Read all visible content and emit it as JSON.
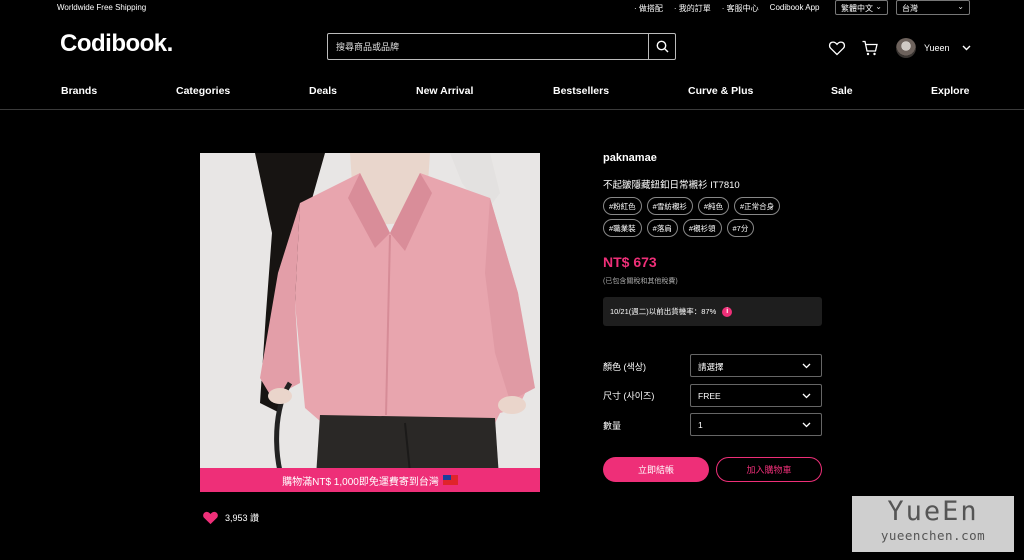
{
  "topbar": {
    "shipping_text": "Worldwide Free Shipping",
    "links": [
      "· 做搭配",
      "· 我的訂單",
      "· 客服中心",
      "Codibook App"
    ],
    "language_select": "繁體中文",
    "region_select": "台灣"
  },
  "header": {
    "logo": "Codibook.",
    "search_placeholder": "搜尋商品或品牌",
    "user_name": "Yueen"
  },
  "nav": [
    "Brands",
    "Categories",
    "Deals",
    "New Arrival",
    "Bestsellers",
    "Curve & Plus",
    "Sale",
    "Explore"
  ],
  "product": {
    "promo_banner": "購物滿NT$ 1,000即免運費寄到台灣",
    "likes": "3,953 讚",
    "brand": "paknamae",
    "name": "不起皺隱藏鈕釦日常襯衫 IT7810",
    "tags": [
      "#粉紅色",
      "#雪紡襯衫",
      "#純色",
      "#正常合身",
      "#職業裝",
      "#落肩",
      "#襯衫領",
      "#7分"
    ],
    "price": "NT$ 673",
    "tax_note": "(已包含關稅和其他稅費)",
    "shipping_rate": "10/21(週二)以前出貨機率：87%",
    "options": [
      {
        "label": "顏色 (색상)",
        "value": "請選擇"
      },
      {
        "label": "尺寸 (사이즈)",
        "value": "FREE"
      },
      {
        "label": "數量",
        "value": "1"
      }
    ],
    "buy_button": "立即結帳",
    "cart_button": "加入購物車"
  },
  "watermark": {
    "line1": "YueEn",
    "line2": "yueenchen.com"
  },
  "colors": {
    "accent": "#ee2f78",
    "background": "#000000",
    "panel": "#1e1e1e"
  }
}
